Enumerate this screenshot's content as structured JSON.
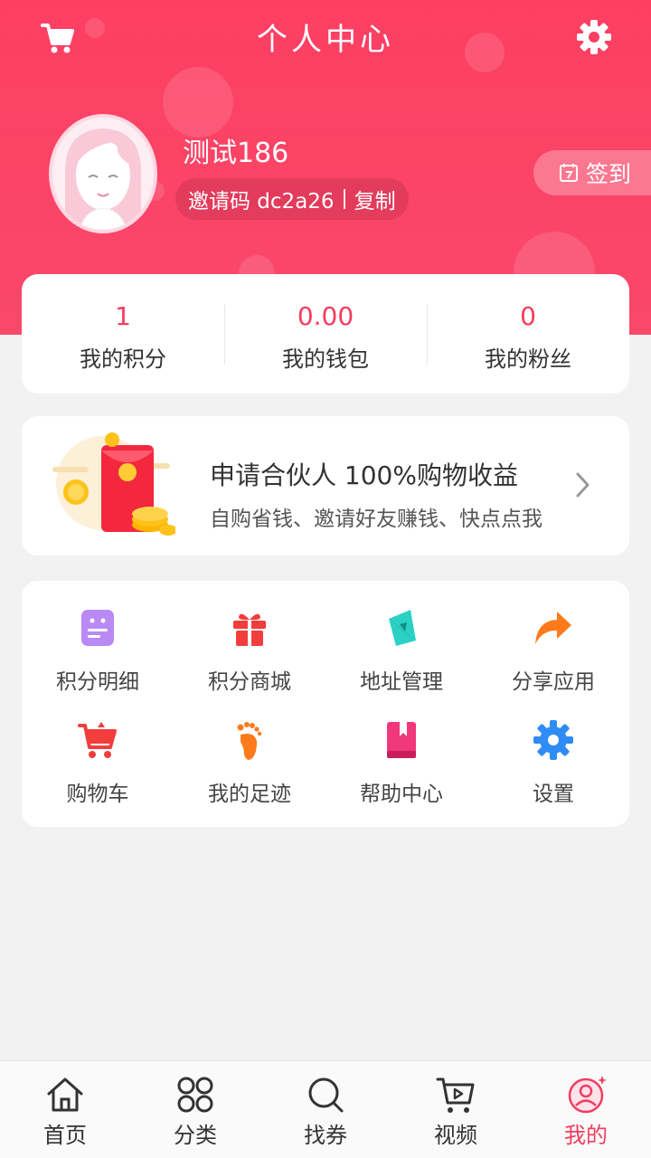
{
  "header": {
    "title": "个人中心",
    "cart_icon": "cart-icon",
    "settings_icon": "gear-icon"
  },
  "profile": {
    "username": "测试186",
    "invite_text": "邀请码 dc2a26",
    "copy_label": "复制",
    "signin_label": "签到",
    "avatar_icon": "avatar"
  },
  "stats": [
    {
      "value": "1",
      "label": "我的积分"
    },
    {
      "value": "0.00",
      "label": "我的钱包"
    },
    {
      "value": "0",
      "label": "我的粉丝"
    }
  ],
  "partner": {
    "title": "申请合伙人 100%购物收益",
    "subtitle": "自购省钱、邀请好友赚钱、快点点我"
  },
  "menu": [
    {
      "label": "积分明细",
      "icon": "points-detail-icon"
    },
    {
      "label": "积分商城",
      "icon": "gift-icon"
    },
    {
      "label": "地址管理",
      "icon": "compass-icon"
    },
    {
      "label": "分享应用",
      "icon": "share-icon"
    },
    {
      "label": "购物车",
      "icon": "cart-icon"
    },
    {
      "label": "我的足迹",
      "icon": "footprint-icon"
    },
    {
      "label": "帮助中心",
      "icon": "book-icon"
    },
    {
      "label": "设置",
      "icon": "gear-icon"
    }
  ],
  "tabs": [
    {
      "label": "首页",
      "icon": "home-icon"
    },
    {
      "label": "分类",
      "icon": "category-icon"
    },
    {
      "label": "找券",
      "icon": "search-icon"
    },
    {
      "label": "视频",
      "icon": "video-cart-icon"
    },
    {
      "label": "我的",
      "icon": "profile-icon",
      "active": true
    }
  ],
  "colors": {
    "accent": "#f23d5f",
    "header_bg": "#fd3f63"
  }
}
